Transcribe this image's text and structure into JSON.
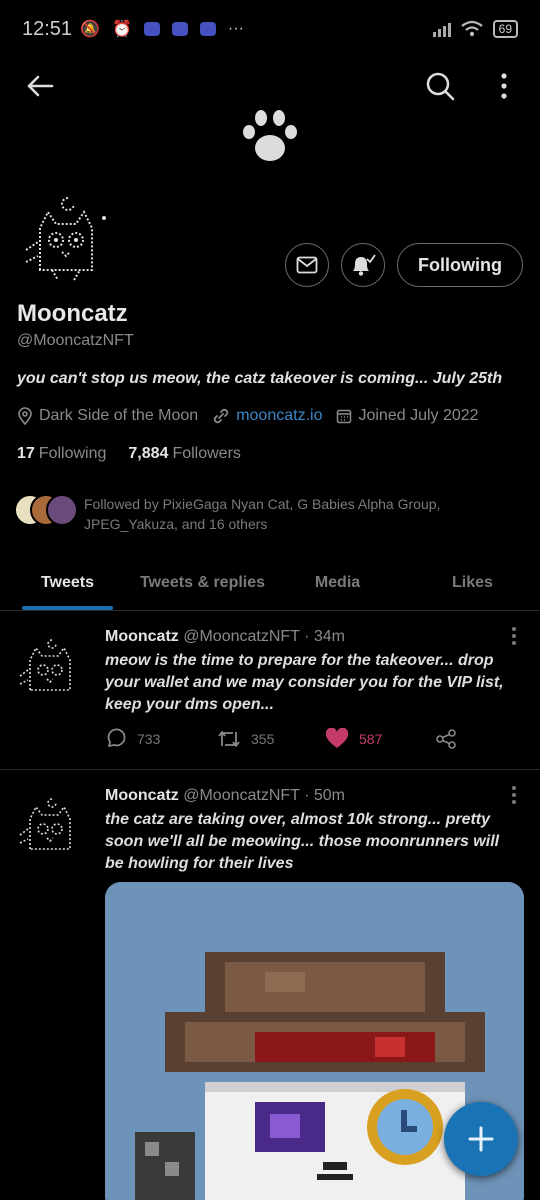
{
  "status": {
    "time": "12:51",
    "battery": "69"
  },
  "profile": {
    "name": "Mooncatz",
    "handle": "@MooncatzNFT",
    "bio": "you can't stop us meow, the catz takeover is coming... July 25th",
    "location": "Dark Side of the Moon",
    "website": "mooncatz.io",
    "joined": "Joined July 2022",
    "following_count": "17",
    "following_label": "Following",
    "followers_count": "7,884",
    "followers_label": "Followers",
    "following_button": "Following",
    "followed_by": "Followed by PixieGaga Nyan Cat, G Babies Alpha Group, JPEG_Yakuza, and 16 others"
  },
  "tabs": [
    {
      "label": "Tweets",
      "active": true
    },
    {
      "label": "Tweets & replies",
      "active": false
    },
    {
      "label": "Media",
      "active": false
    },
    {
      "label": "Likes",
      "active": false
    }
  ],
  "tweets": [
    {
      "name": "Mooncatz",
      "handle": "@MooncatzNFT",
      "time": "· 34m",
      "text": "meow is the time to prepare for the takeover... drop your wallet and we may consider you for the VIP list, keep your dms open...",
      "replies": "733",
      "retweets": "355",
      "likes": "587"
    },
    {
      "name": "Mooncatz",
      "handle": "@MooncatzNFT",
      "time": "· 50m",
      "text": "the catz are taking over, almost 10k strong... pretty soon we'll all be meowing... those moonrunners will be howling for their lives"
    }
  ],
  "colors": {
    "accent": "#1d6fb0",
    "like": "#c43b6b",
    "link": "#3a87c8",
    "fab": "#1a73b5"
  },
  "icons": [
    "back-arrow-icon",
    "search-icon",
    "more-vert-icon",
    "paw-icon",
    "mail-icon",
    "bell-icon",
    "location-icon",
    "link-icon",
    "calendar-icon",
    "reply-icon",
    "retweet-icon",
    "heart-icon",
    "share-icon",
    "plus-icon"
  ]
}
